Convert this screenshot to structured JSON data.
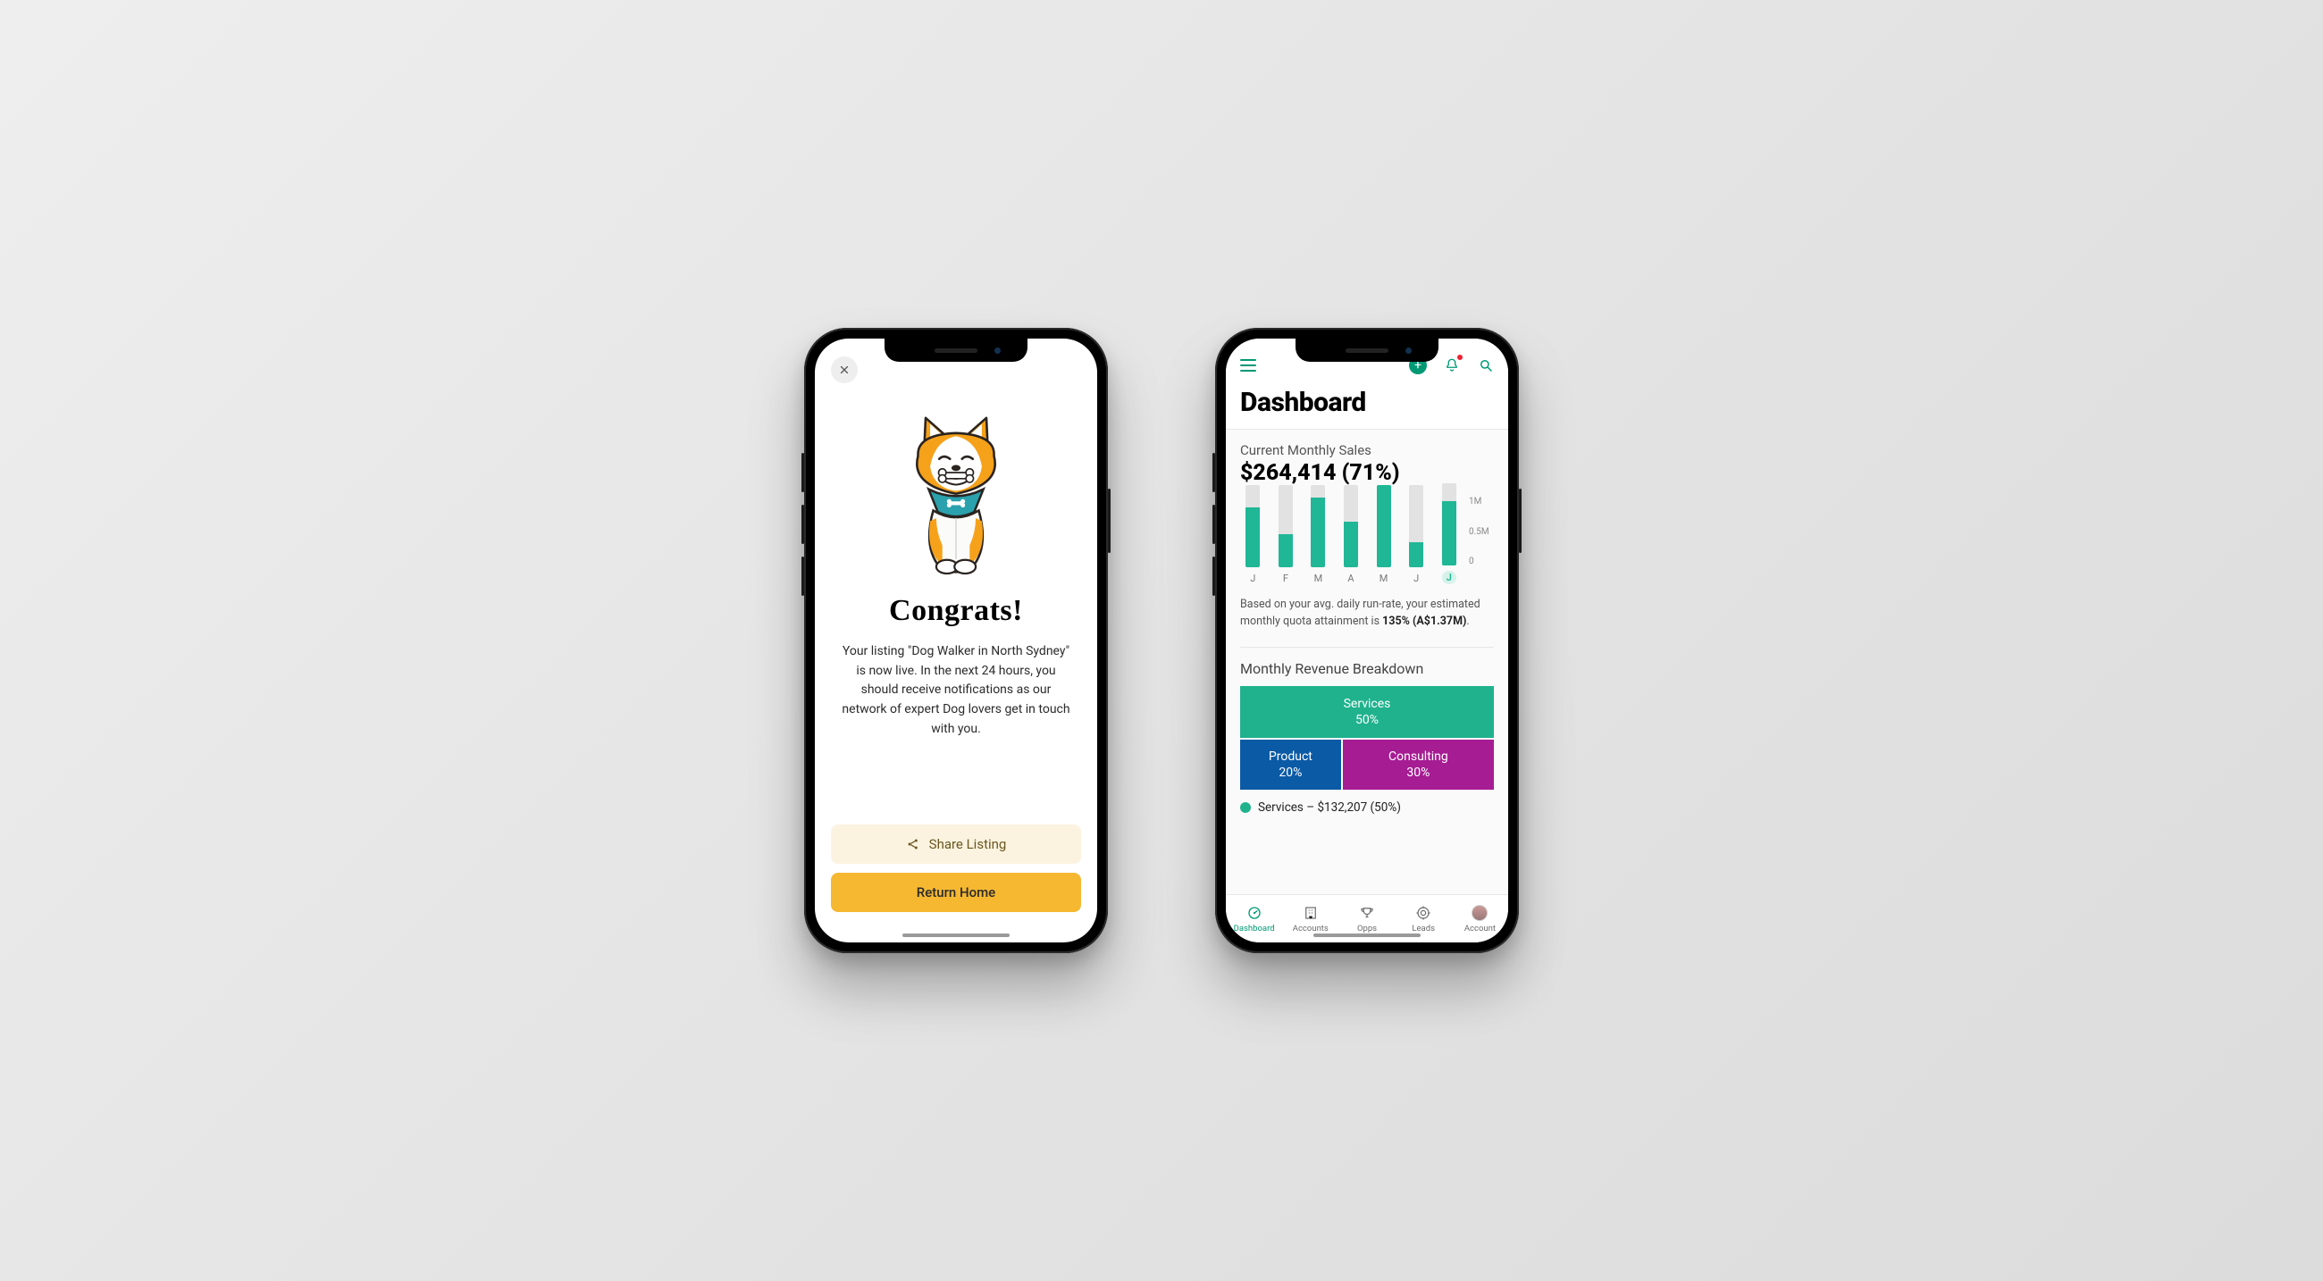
{
  "phone1": {
    "close_aria": "Close",
    "title": "Congrats!",
    "body": "Your listing \"Dog Walker in North Sydney\" is now live. In the next 24 hours, you should receive notifications as our network of expert Dog lovers get in touch with you.",
    "share_label": "Share Listing",
    "home_label": "Return Home"
  },
  "phone2": {
    "header": {
      "title": "Dashboard"
    },
    "sales": {
      "label": "Current Monthly Sales",
      "value": "$264,414 (71%)"
    },
    "runrate": {
      "prefix": "Based on your avg. daily run-rate, your estimated monthly quota attainment is ",
      "bold": "135% (A$1.37M)",
      "suffix": "."
    },
    "breakdown": {
      "title": "Monthly Revenue Breakdown",
      "services_label": "Services",
      "services_pct": "50%",
      "product_label": "Product",
      "product_pct": "20%",
      "consulting_label": "Consulting",
      "consulting_pct": "30%",
      "legend": "Services – $132,207 (50%)"
    },
    "tabs": {
      "dashboard": "Dashboard",
      "accounts": "Accounts",
      "opps": "Opps",
      "leads": "Leads",
      "account": "Account"
    },
    "yaxis": {
      "t0": "1M",
      "t1": "0.5M",
      "t2": "0"
    }
  },
  "chart_data": {
    "type": "bar",
    "categories": [
      "J",
      "F",
      "M",
      "A",
      "M",
      "J",
      "J"
    ],
    "values_million": [
      0.73,
      0.4,
      0.85,
      0.55,
      1.0,
      0.3,
      0.78
    ],
    "title": "Current Monthly Sales",
    "xlabel": "",
    "ylabel": "",
    "ylim": [
      0,
      1
    ],
    "y_ticks": [
      "0",
      "0.5M",
      "1M"
    ],
    "current_index": 6
  }
}
